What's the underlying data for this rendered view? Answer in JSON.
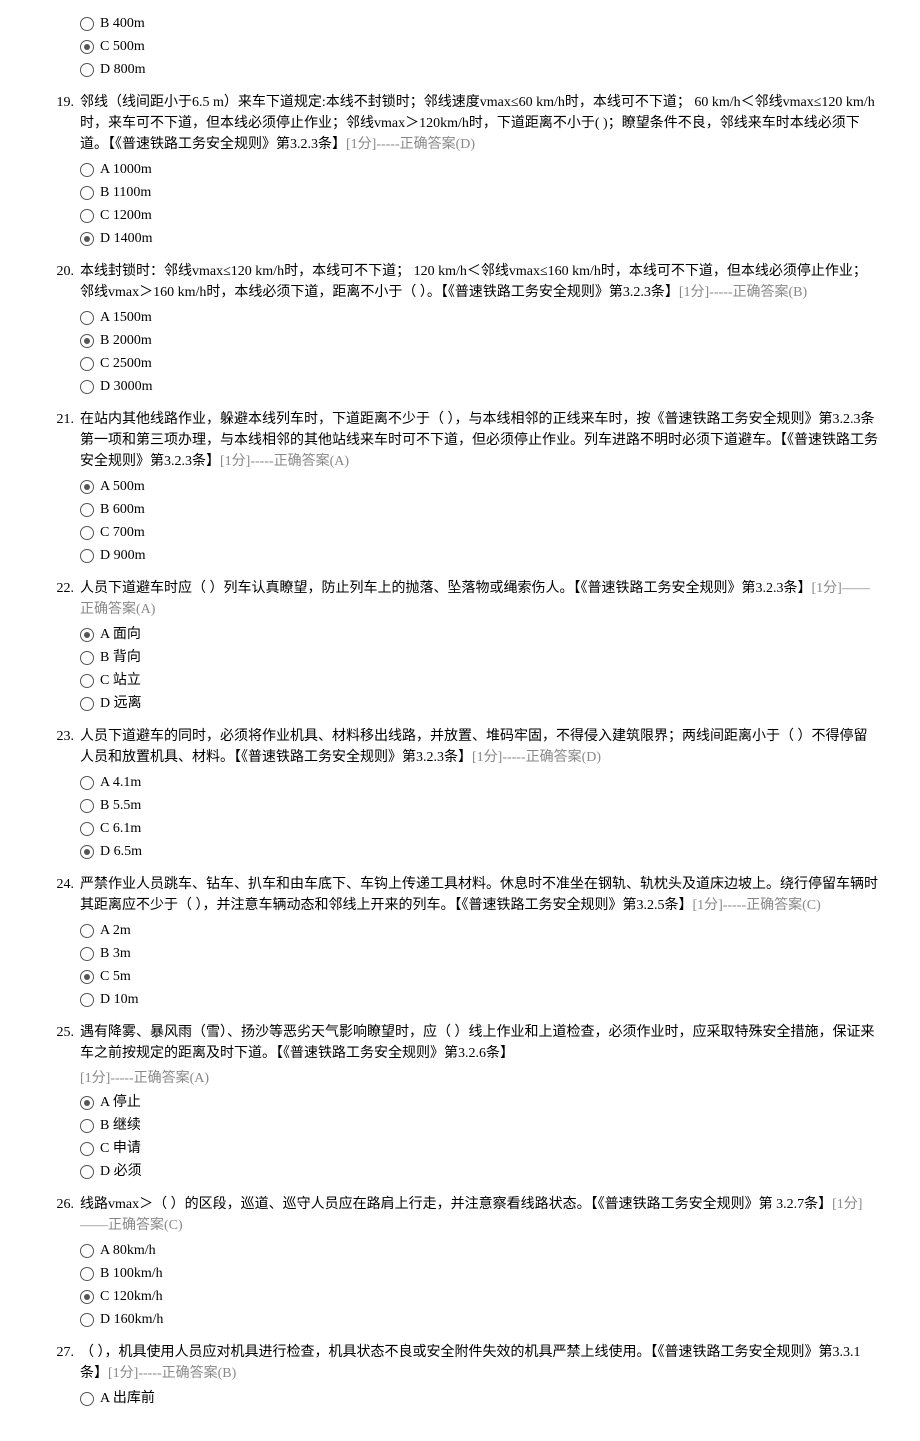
{
  "questions": [
    {
      "number": "",
      "text": "",
      "meta": "",
      "partial": true,
      "options": [
        {
          "label": "B  400m",
          "selected": false
        },
        {
          "label": "C  500m",
          "selected": true
        },
        {
          "label": "D  800m",
          "selected": false
        }
      ]
    },
    {
      "number": "19.",
      "text": "邻线（线间距小于6.5 m）来车下道规定:本线不封锁时；邻线速度vmax≤60 km/h时，本线可不下道；  60 km/h＜邻线vmax≤120 km/h时，来车可不下道，但本线必须停止作业；邻线vmax＞120km/h时，下道距离不小于(   )；瞭望条件不良，邻线来车时本线必须下道。【《普速铁路工务安全规则》第3.2.3条】",
      "meta": "[1分]-----正确答案(D)",
      "options": [
        {
          "label": "A  1000m",
          "selected": false
        },
        {
          "label": "B  1100m",
          "selected": false
        },
        {
          "label": "C  1200m",
          "selected": false
        },
        {
          "label": "D  1400m",
          "selected": true
        }
      ]
    },
    {
      "number": "20.",
      "text": "本线封锁时：邻线vmax≤120 km/h时，本线可不下道；  120 km/h＜邻线vmax≤160 km/h时，本线可不下道，但本线必须停止作业；邻线vmax＞160 km/h时，本线必须下道，距离不小于（  ）。【《普速铁路工务安全规则》第3.2.3条】",
      "meta": "[1分]-----正确答案(B)",
      "options": [
        {
          "label": "A  1500m",
          "selected": false
        },
        {
          "label": "B  2000m",
          "selected": true
        },
        {
          "label": "C  2500m",
          "selected": false
        },
        {
          "label": "D  3000m",
          "selected": false
        }
      ]
    },
    {
      "number": "21.",
      "text": "在站内其他线路作业，躲避本线列车时，下道距离不少于（  ），与本线相邻的正线来车时，按《普速铁路工务安全规则》第3.2.3条第一项和第三项办理，与本线相邻的其他站线来车时可不下道，但必须停止作业。列车进路不明时必须下道避车。【《普速铁路工务安全规则》第3.2.3条】",
      "meta": "[1分]-----正确答案(A)",
      "options": [
        {
          "label": "A  500m",
          "selected": true
        },
        {
          "label": "B  600m",
          "selected": false
        },
        {
          "label": "C  700m",
          "selected": false
        },
        {
          "label": "D  900m",
          "selected": false
        }
      ]
    },
    {
      "number": "22.",
      "text": "人员下道避车时应（  ）列车认真瞭望，防止列车上的抛落、坠落物或绳索伤人。【《普速铁路工务安全规则》第3.2.3条】",
      "meta": "[1分]——正确答案(A)",
      "options": [
        {
          "label": "A  面向",
          "selected": true
        },
        {
          "label": "B  背向",
          "selected": false
        },
        {
          "label": "C  站立",
          "selected": false
        },
        {
          "label": "D  远离",
          "selected": false
        }
      ]
    },
    {
      "number": "23.",
      "text": "人员下道避车的同时，必须将作业机具、材料移出线路，并放置、堆码牢固，不得侵入建筑限界；两线间距离小于（  ）不得停留人员和放置机具、材料。【《普速铁路工务安全规则》第3.2.3条】",
      "meta": "[1分]-----正确答案(D)",
      "options": [
        {
          "label": "A  4.1m",
          "selected": false
        },
        {
          "label": "B  5.5m",
          "selected": false
        },
        {
          "label": "C  6.1m",
          "selected": false
        },
        {
          "label": "D  6.5m",
          "selected": true
        }
      ]
    },
    {
      "number": "24.",
      "text": "严禁作业人员跳车、钻车、扒车和由车底下、车钩上传递工具材料。休息时不准坐在钢轨、轨枕头及道床边坡上。绕行停留车辆时其距离应不少于（  ），并注意车辆动态和邻线上开来的列车。【《普速铁路工务安全规则》第3.2.5条】",
      "meta": "[1分]-----正确答案(C)",
      "options": [
        {
          "label": "A  2m",
          "selected": false
        },
        {
          "label": "B  3m",
          "selected": false
        },
        {
          "label": "C  5m",
          "selected": true
        },
        {
          "label": "D  10m",
          "selected": false
        }
      ]
    },
    {
      "number": "25.",
      "text": "遇有降雾、暴风雨（雪）、扬沙等恶劣天气影响瞭望时，应（ ）线上作业和上道检查，必须作业时，应采取特殊安全措施，保证来车之前按规定的距离及时下道。【《普速铁路工务安全规则》第3.2.6条】",
      "meta_newline": true,
      "meta": "[1分]-----正确答案(A)",
      "options": [
        {
          "label": "A  停止",
          "selected": true
        },
        {
          "label": "B  继续",
          "selected": false
        },
        {
          "label": "C  申请",
          "selected": false
        },
        {
          "label": "D  必须",
          "selected": false
        }
      ]
    },
    {
      "number": "26.",
      "text": "线路vmax＞（  ）的区段，巡道、巡守人员应在路肩上行走，并注意察看线路状态。【《普速铁路工务安全规则》第 3.2.7条】",
      "meta": "[1分]——正确答案(C)",
      "options": [
        {
          "label": "A  80km/h",
          "selected": false
        },
        {
          "label": "B  100km/h",
          "selected": false
        },
        {
          "label": "C  120km/h",
          "selected": true
        },
        {
          "label": "D  160km/h",
          "selected": false
        }
      ]
    },
    {
      "number": "27.",
      "text": "（  ），机具使用人员应对机具进行检查，机具状态不良或安全附件失效的机具严禁上线使用。【《普速铁路工务安全规则》第3.3.1条】",
      "meta": "[1分]-----正确答案(B)",
      "options": [
        {
          "label": "A  出库前",
          "selected": false
        }
      ]
    }
  ]
}
